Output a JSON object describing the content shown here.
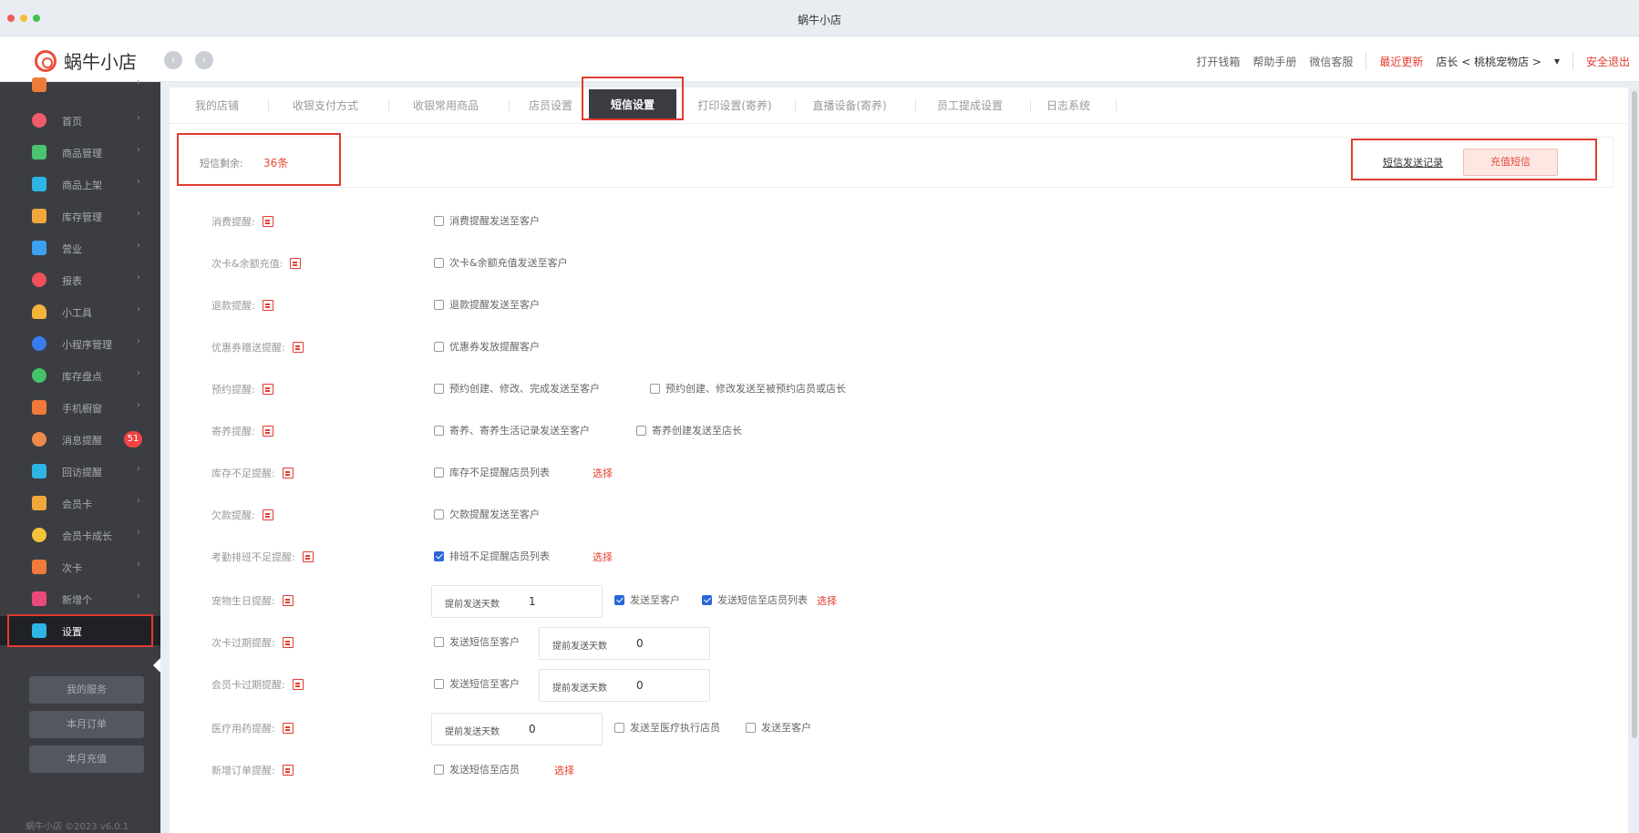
{
  "window": {
    "title": "蜗牛小店"
  },
  "appbar": {
    "logo_text": "蜗牛小店",
    "links": [
      "打开钱箱",
      "帮助手册",
      "微信客服"
    ],
    "update_link": "最近更新",
    "store_selector": "店长 < 桃桃宠物店 >",
    "dropdown_arrow": "▾",
    "logout": "安全退出"
  },
  "sidebar": {
    "items": [
      {
        "label": "",
        "icon": "orange-square-icon",
        "color": "#ef7a3a"
      },
      {
        "label": "首页",
        "icon": "home-icon",
        "color": "#f15a6a"
      },
      {
        "label": "商品管理",
        "icon": "goods-icon",
        "color": "#4cc36f"
      },
      {
        "label": "商品上架",
        "icon": "shelf-icon",
        "color": "#2fb4e6"
      },
      {
        "label": "库存管理",
        "icon": "stock-icon",
        "color": "#f0a83a"
      },
      {
        "label": "营业",
        "icon": "business-icon",
        "color": "#3aa0ef"
      },
      {
        "label": "报表",
        "icon": "report-icon",
        "color": "#f0505a"
      },
      {
        "label": "小工具",
        "icon": "tools-icon",
        "color": "#f3b43a"
      },
      {
        "label": "小程序管理",
        "icon": "miniapp-icon",
        "color": "#3a7cef"
      },
      {
        "label": "库存盘点",
        "icon": "inventory-icon",
        "color": "#46c268"
      },
      {
        "label": "手机橱窗",
        "icon": "phone-icon",
        "color": "#f07a3a"
      },
      {
        "label": "消息提醒",
        "icon": "message-icon",
        "color": "#f08a4a",
        "badge": "51"
      },
      {
        "label": "回访提醒",
        "icon": "revisit-icon",
        "color": "#2fb4e6"
      },
      {
        "label": "会员卡",
        "icon": "card-icon",
        "color": "#f0a83a"
      },
      {
        "label": "会员卡成长",
        "icon": "growth-icon",
        "color": "#f3c43a"
      },
      {
        "label": "次卡",
        "icon": "times-card-icon",
        "color": "#f07a3a"
      },
      {
        "label": "新增个",
        "icon": "add-icon",
        "color": "#e94a7a"
      },
      {
        "label": "设置",
        "icon": "settings-icon",
        "color": "#2fb4e6",
        "active": true
      }
    ],
    "buttons": [
      "我的服务",
      "本月订单",
      "本月充值"
    ],
    "footer": "蜗牛小店 ©2023 v6.0.1"
  },
  "tabs": [
    "我的店铺",
    "收银支付方式",
    "收银常用商品",
    "店员设置",
    "短信设置",
    "打印设置(寄养)",
    "直播设备(寄养)",
    "员工提成设置",
    "日志系统"
  ],
  "active_tab": "短信设置",
  "sms": {
    "remaining_label": "短信剩余:",
    "remaining_value": "36条",
    "record_link": "短信发送记录",
    "recharge_button": "充值短信"
  },
  "rows": [
    {
      "label": "消费提醒:",
      "options": [
        {
          "text": "消费提醒发送至客户",
          "checked": false
        }
      ]
    },
    {
      "label": "次卡&余额充值:",
      "options": [
        {
          "text": "次卡&余额充值发送至客户",
          "checked": false
        }
      ]
    },
    {
      "label": "退款提醒:",
      "options": [
        {
          "text": "退款提醒发送至客户",
          "checked": false
        }
      ]
    },
    {
      "label": "优惠券赠送提醒:",
      "options": [
        {
          "text": "优惠券发放提醒客户",
          "checked": false
        }
      ]
    },
    {
      "label": "预约提醒:",
      "options": [
        {
          "text": "预约创建、修改、完成发送至客户",
          "checked": false
        },
        {
          "text": "预约创建、修改发送至被预约店员或店长",
          "checked": false
        }
      ]
    },
    {
      "label": "寄养提醒:",
      "options": [
        {
          "text": "寄养、寄养生活记录发送至客户",
          "checked": false
        },
        {
          "text": "寄养创建发送至店长",
          "checked": false
        }
      ]
    },
    {
      "label": "库存不足提醒:",
      "options": [
        {
          "text": "库存不足提醒店员列表",
          "checked": false
        }
      ],
      "select": "选择"
    },
    {
      "label": "欠款提醒:",
      "options": [
        {
          "text": "欠款提醒发送至客户",
          "checked": false
        }
      ]
    },
    {
      "label": "考勤排班不足提醒:",
      "options": [
        {
          "text": "排班不足提醒店员列表",
          "checked": true
        }
      ],
      "select": "选择"
    },
    {
      "label": "宠物生日提醒:",
      "days_label": "提前发送天数",
      "days_value": "1",
      "options": [
        {
          "text": "发送至客户",
          "checked": true
        },
        {
          "text": "发送短信至店员列表",
          "checked": true
        }
      ],
      "select": "选择"
    },
    {
      "label": "次卡过期提醒:",
      "options": [
        {
          "text": "发送短信至客户",
          "checked": false
        }
      ],
      "days_label": "提前发送天数",
      "days_value": "0"
    },
    {
      "label": "会员卡过期提醒:",
      "options": [
        {
          "text": "发送短信至客户",
          "checked": false
        }
      ],
      "days_label": "提前发送天数",
      "days_value": "0"
    },
    {
      "label": "医疗用药提醒:",
      "days_label": "提前发送天数",
      "days_value": "0",
      "options": [
        {
          "text": "发送至医疗执行店员",
          "checked": false
        },
        {
          "text": "发送至客户",
          "checked": false
        }
      ]
    },
    {
      "label": "新增订单提醒:",
      "options": [
        {
          "text": "发送短信至店员",
          "checked": false
        }
      ],
      "select": "选择"
    }
  ]
}
